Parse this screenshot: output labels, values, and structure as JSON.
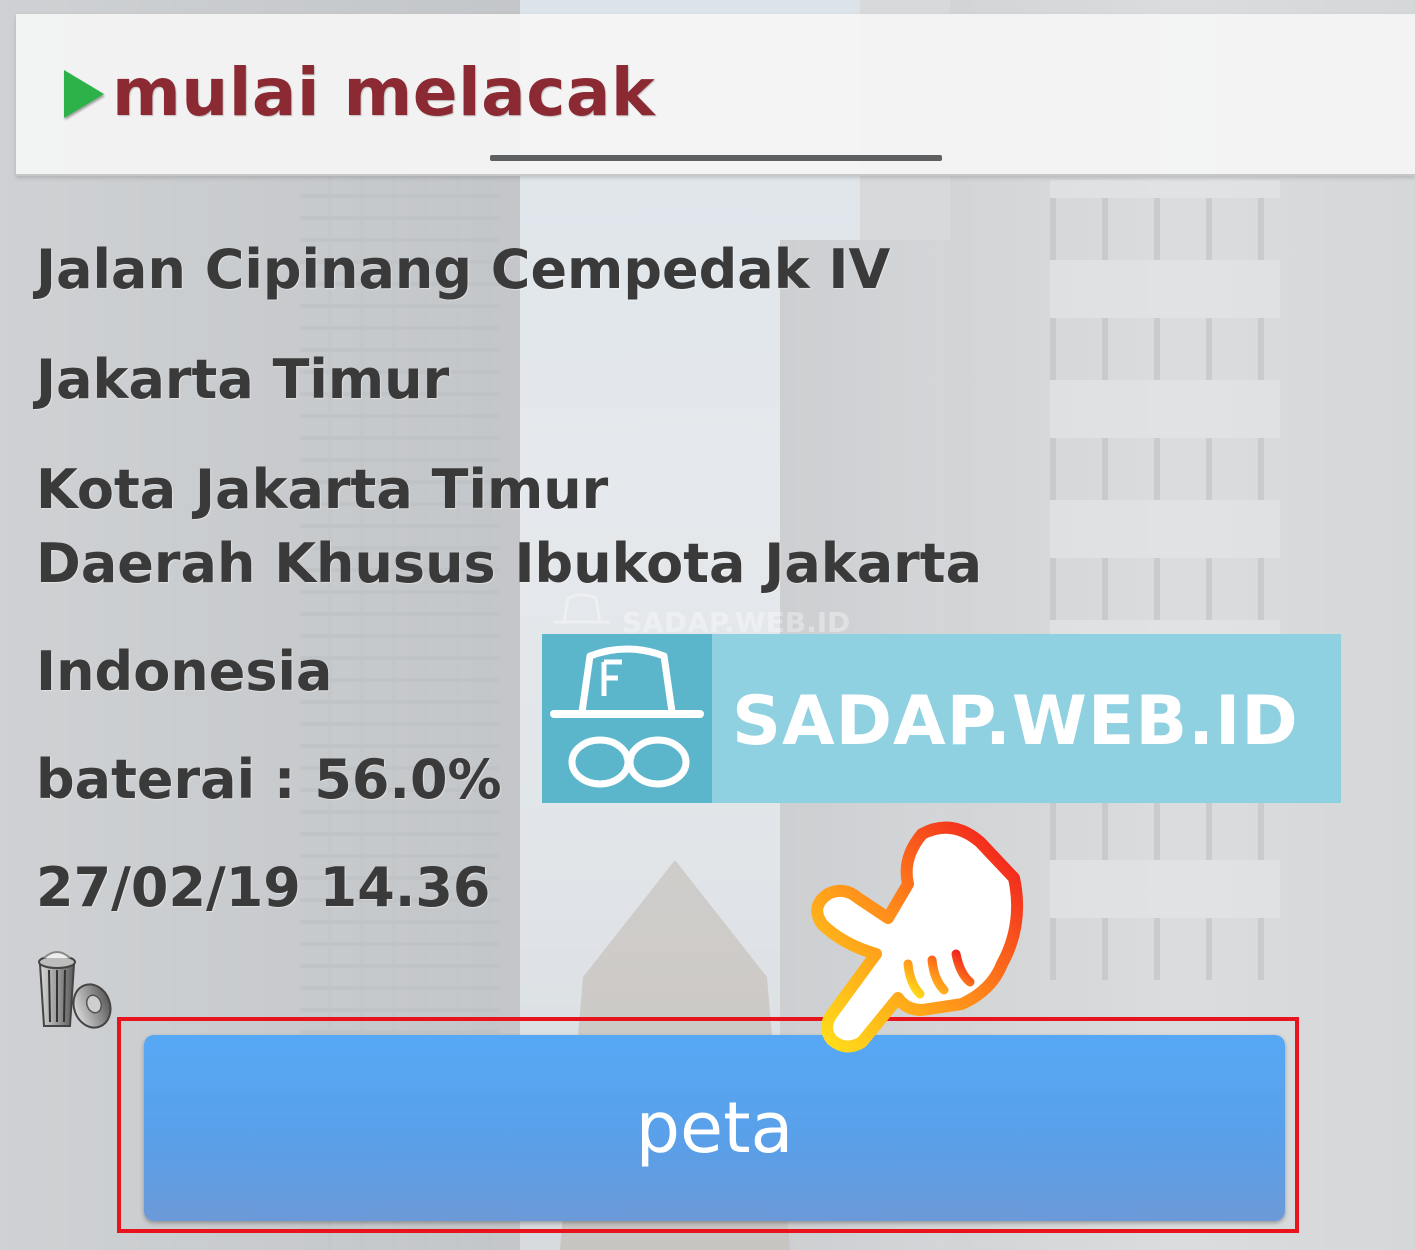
{
  "header": {
    "title": "mulai melacak"
  },
  "location": {
    "street": "Jalan Cipinang Cempedak IV",
    "city": "Jakarta Timur",
    "kota": "Kota Jakarta Timur",
    "region": "Daerah Khusus Ibukota Jakarta",
    "country": "Indonesia"
  },
  "battery": {
    "label": "baterai",
    "value": "56.0%"
  },
  "timestamp": "27/02/19 14.36",
  "watermark": {
    "text": "SADAP.WEB.ID",
    "small_text": "SADAP.WEB.ID"
  },
  "map_button": {
    "label": "peta"
  },
  "colors": {
    "title": "#8c2a33",
    "play_icon": "#2db24a",
    "button": "#56a8f5",
    "highlight": "#e8141d",
    "logo_bg": "#8fd1e1"
  },
  "icons": [
    "play-icon",
    "trash-icon",
    "incognito-hat-icon",
    "pointing-hand-icon"
  ]
}
